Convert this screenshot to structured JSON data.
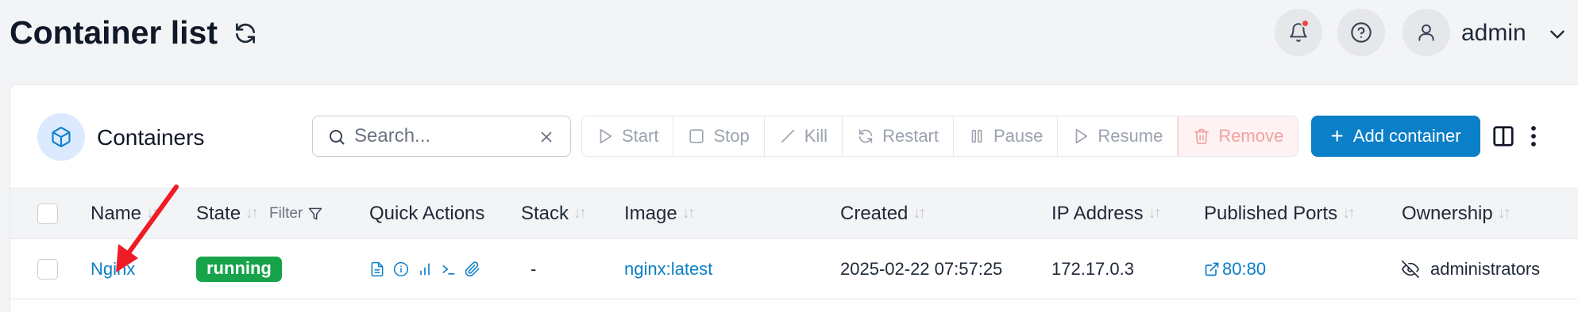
{
  "header": {
    "title": "Container list",
    "user_name": "admin",
    "icons": [
      "refresh-icon",
      "bell-icon",
      "help-icon",
      "user-icon",
      "chevron-down-icon"
    ],
    "notification_dot_color": "#ef4444"
  },
  "widget": {
    "title": "Containers",
    "icon": "box-icon",
    "search": {
      "placeholder": "Search...",
      "value": ""
    },
    "actions": [
      {
        "label": "Start",
        "icon": "play-icon",
        "enabled": false
      },
      {
        "label": "Stop",
        "icon": "square-icon",
        "enabled": false
      },
      {
        "label": "Kill",
        "icon": "slash-icon",
        "enabled": false
      },
      {
        "label": "Restart",
        "icon": "refresh-icon",
        "enabled": false
      },
      {
        "label": "Pause",
        "icon": "pause-icon",
        "enabled": false
      },
      {
        "label": "Resume",
        "icon": "play-icon",
        "enabled": false
      },
      {
        "label": "Remove",
        "icon": "trash-icon",
        "enabled": false
      }
    ],
    "add_button": "Add container",
    "accent_color": "#0b7fc7"
  },
  "table": {
    "columns": [
      {
        "key": "name",
        "label": "Name"
      },
      {
        "key": "state",
        "label": "State",
        "filter_label": "Filter"
      },
      {
        "key": "quick_actions",
        "label": "Quick Actions"
      },
      {
        "key": "stack",
        "label": "Stack"
      },
      {
        "key": "image",
        "label": "Image"
      },
      {
        "key": "created",
        "label": "Created"
      },
      {
        "key": "ip",
        "label": "IP Address"
      },
      {
        "key": "ports",
        "label": "Published Ports"
      },
      {
        "key": "ownership",
        "label": "Ownership"
      }
    ],
    "rows": [
      {
        "name": "Nginx",
        "state": "running",
        "state_color": "#16a34a",
        "quick_actions": [
          "logs-icon",
          "info-icon",
          "stats-icon",
          "console-icon",
          "attach-icon"
        ],
        "stack": "-",
        "image": "nginx:latest",
        "created": "2025-02-22 07:57:25",
        "ip": "172.17.0.3",
        "ports": "80:80",
        "ownership": "administrators"
      }
    ]
  },
  "annotation": {
    "color": "#ee1c25"
  }
}
